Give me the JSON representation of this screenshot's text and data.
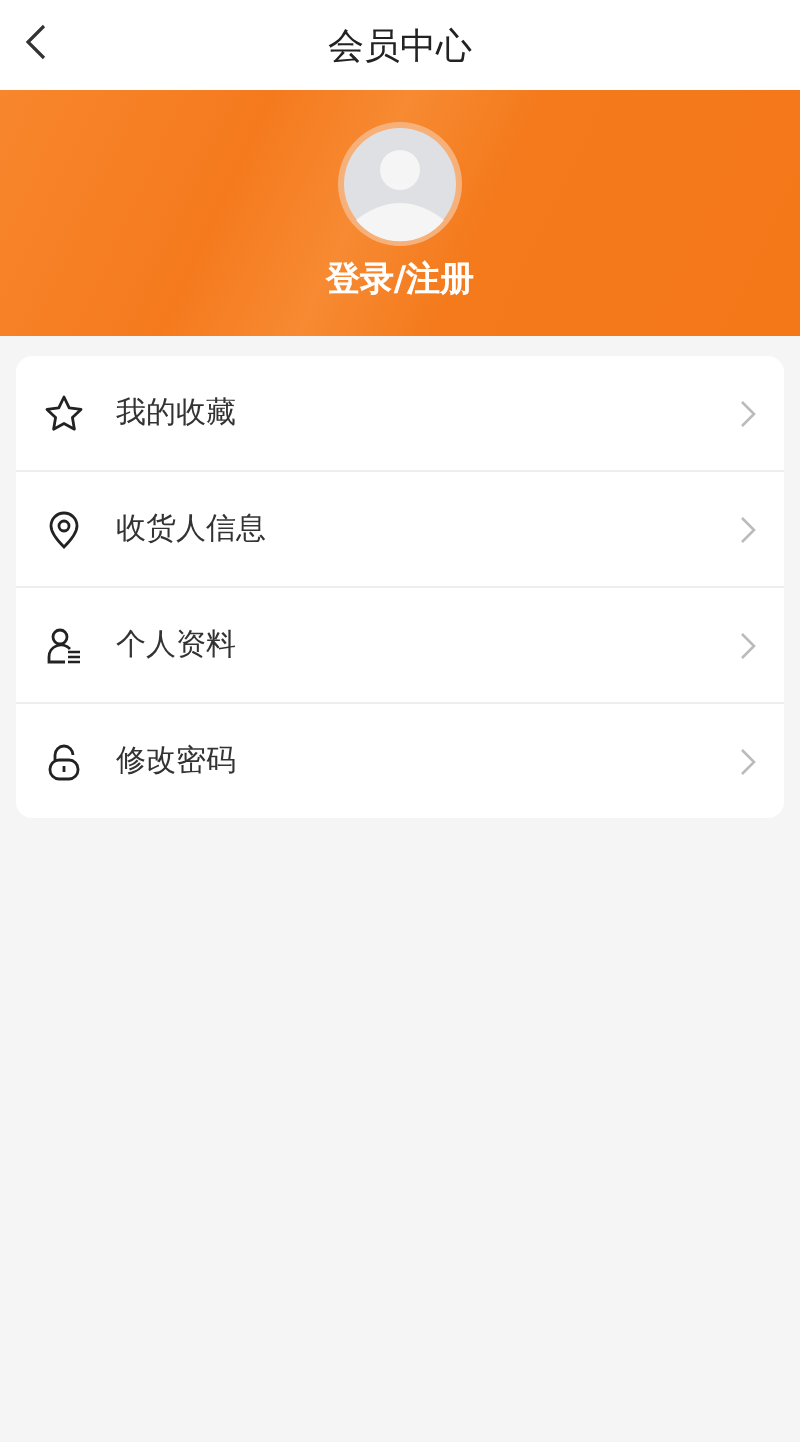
{
  "header": {
    "title": "会员中心"
  },
  "profile": {
    "login_label": "登录/注册"
  },
  "menu": [
    {
      "kind": "star",
      "label": "我的收藏"
    },
    {
      "kind": "location",
      "label": "收货人信息"
    },
    {
      "kind": "profile",
      "label": "个人资料"
    },
    {
      "kind": "lock",
      "label": "修改密码"
    }
  ]
}
